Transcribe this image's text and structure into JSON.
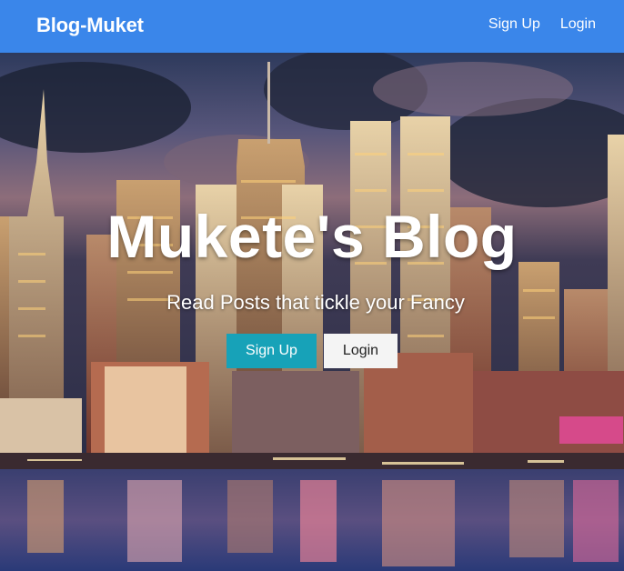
{
  "navbar": {
    "brand": "Blog-Muket",
    "links": [
      {
        "label": "Sign Up"
      },
      {
        "label": "Login"
      }
    ],
    "color": "#3a86ea"
  },
  "hero": {
    "title": "Mukete's Blog",
    "subtitle": "Read Posts that tickle your Fancy",
    "primary_button": "Sign Up",
    "secondary_button": "Login",
    "background": "city-skyline-night-image"
  },
  "colors": {
    "primary_button": "#17a2b8",
    "secondary_button": "#f4f4f4"
  }
}
